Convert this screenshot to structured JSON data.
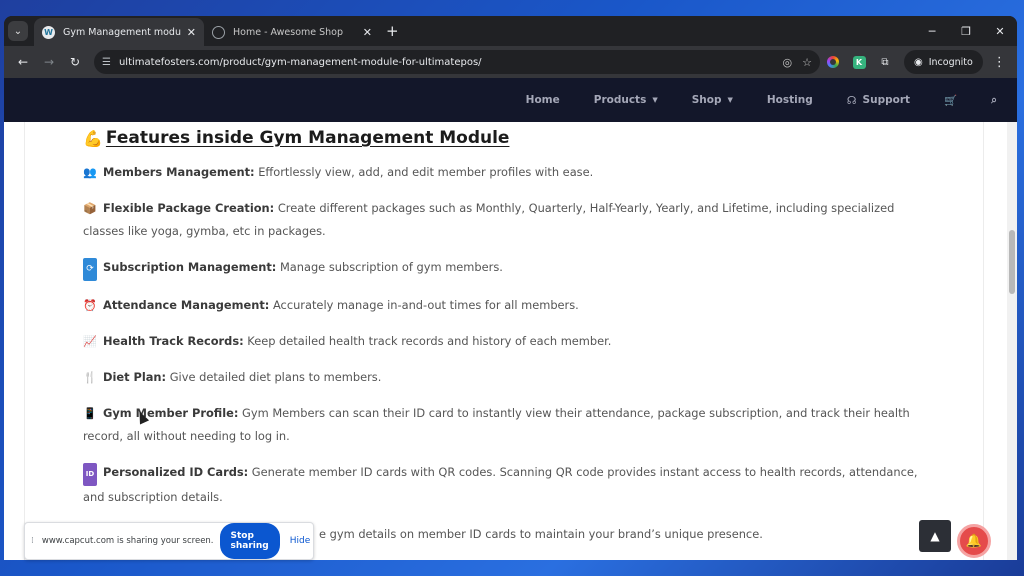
{
  "browser": {
    "tabs": [
      {
        "title": "Gym Management module for U",
        "active": true
      },
      {
        "title": "Home - Awesome Shop",
        "active": false
      }
    ],
    "url": "ultimatefosters.com/product/gym-management-module-for-ultimatepos/",
    "profile_label": "Incognito"
  },
  "site_nav": {
    "items": [
      "Home",
      "Products",
      "Shop",
      "Hosting",
      "Support"
    ]
  },
  "content": {
    "heading": "Features inside Gym Management Module",
    "features": [
      {
        "icon": "people-icon",
        "title": "Members Management:",
        "text": " Effortlessly view, add, and edit member profiles with ease."
      },
      {
        "icon": "package-icon",
        "title": "Flexible Package Creation:",
        "text": " Create different packages such as Monthly, Quarterly, Half-Yearly, Yearly, and Lifetime, including specialized classes like yoga, gymba, etc in packages."
      },
      {
        "icon": "repeat-icon",
        "title": "Subscription Management:",
        "text": " Manage subscription of gym members."
      },
      {
        "icon": "alarm-clock-icon",
        "title": "Attendance Management:",
        "text": " Accurately manage in-and-out times for all members."
      },
      {
        "icon": "chart-icon",
        "title": "Health Track Records:",
        "text": " Keep detailed health track records and history of each member."
      },
      {
        "icon": "fork-knife-icon",
        "title": "Diet Plan:",
        "text": " Give detailed diet plans to members."
      },
      {
        "icon": "phone-icon",
        "title": "Gym Member Profile:",
        "text": " Gym Members can scan their ID card to instantly view their attendance, package subscription, and track their health record, all without needing to log in."
      },
      {
        "icon": "id-icon",
        "title": "Personalized ID Cards:",
        "text": " Generate member ID cards with QR codes. Scanning QR code provides instant access to health records, attendance, and subscription details."
      }
    ],
    "partial_line": "e gym details on member ID cards to maintain your brand’s unique presence."
  },
  "sharing_bar": {
    "message": "www.capcut.com is sharing your screen.",
    "stop_label": "Stop sharing",
    "hide_label": "Hide"
  },
  "colors": {
    "nav_bg": "#13172a",
    "stop_button": "#0b57d0",
    "bell": "#e54b4b"
  }
}
